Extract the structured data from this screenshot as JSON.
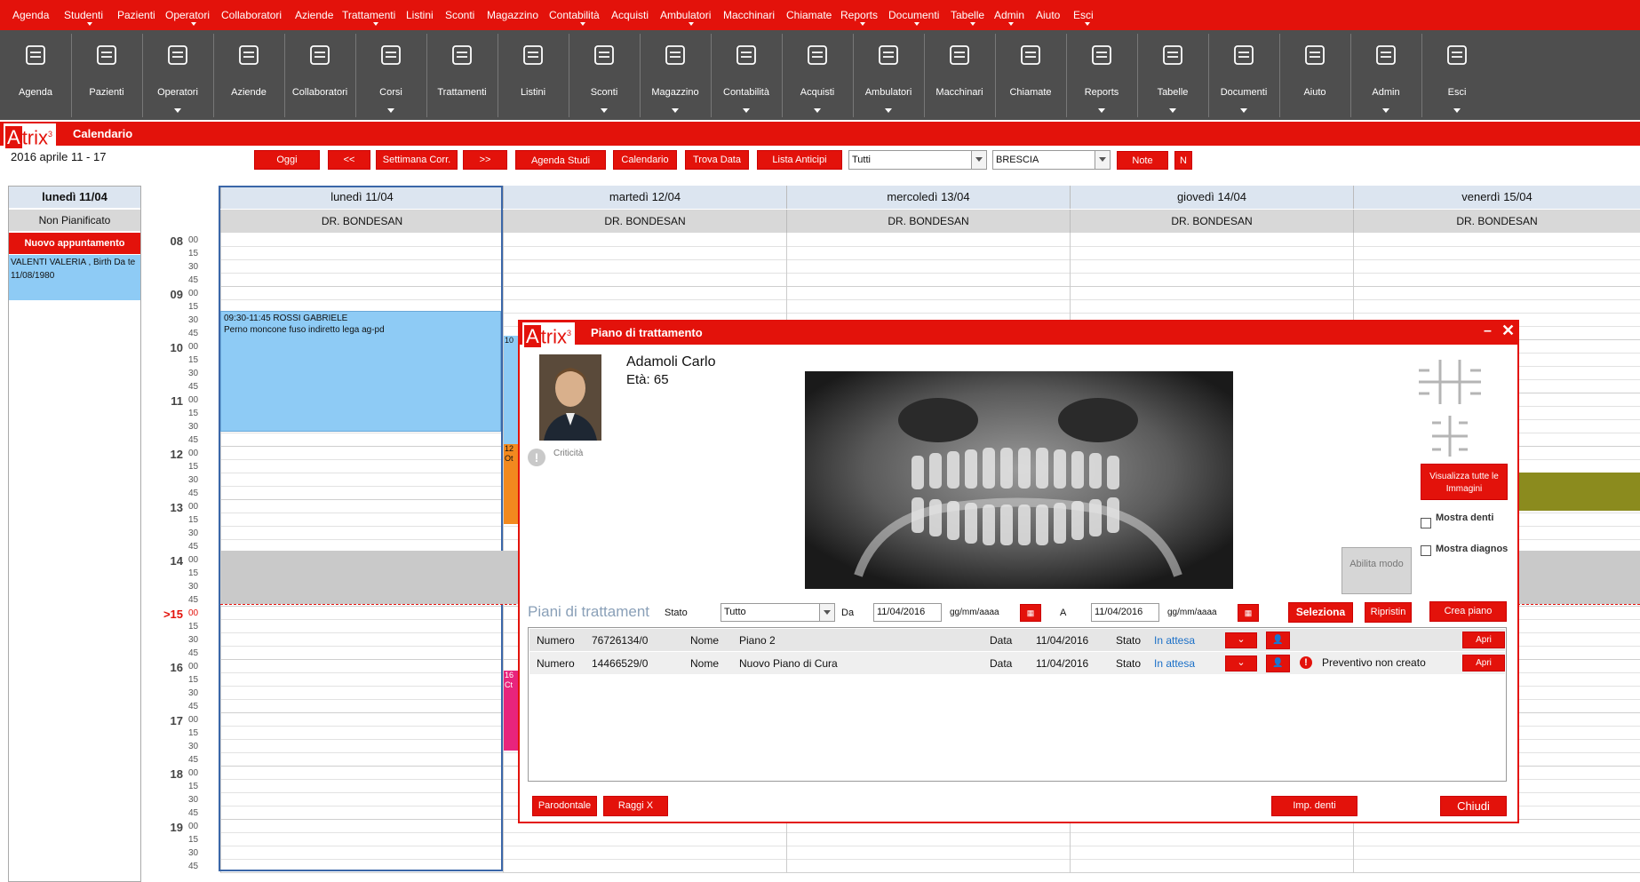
{
  "menu": [
    "Agenda",
    "Studenti",
    "Pazienti",
    "Operatori",
    "Collaboratori",
    "Aziende",
    "Trattamenti",
    "Listini",
    "Sconti",
    "Magazzino",
    "Contabilità",
    "Acquisti",
    "Ambulatori",
    "Macchinari",
    "Chiamate",
    "Reports",
    "Documenti",
    "Tabelle",
    "Admin",
    "Aiuto",
    "Esci"
  ],
  "toolbar": [
    "Agenda",
    "Pazienti",
    "Operatori",
    "Aziende",
    "Collaboratori",
    "Corsi",
    "Trattamenti",
    "Listini",
    "Sconti",
    "Magazzino",
    "Contabilità",
    "Acquisti",
    "Ambulatori",
    "Macchinari",
    "Chiamate",
    "Reports",
    "Tabelle",
    "Documenti",
    "Aiuto",
    "Admin",
    "Esci"
  ],
  "brand": {
    "logo_a": "A",
    "logo_rest": "trix",
    "logo_sup": "3"
  },
  "window_title": "Calendario",
  "week_label": "2016 aprile 11 - 17",
  "nav": {
    "oggi": "Oggi",
    "prev": "<<",
    "settimana": "Settimana Corr.",
    "next": ">>",
    "agenda_studi": "Agenda Studi",
    "calendario": "Calendario",
    "trova_data": "Trova Data",
    "lista_anticipi": "Lista Anticipi",
    "filter_operator": "Tutti",
    "filter_city": "BRESCIA",
    "note": "Note",
    "n": "N"
  },
  "sidebar": {
    "day": "lunedì 11/04",
    "unplanned": "Non Pianificato",
    "new_appointment": "Nuovo appuntamento",
    "pending_item": "VALENTI VALERIA , Birth Da te 11/08/1980"
  },
  "hours": [
    "08",
    "09",
    "10",
    "11",
    "12",
    "13",
    "14",
    ">15",
    "16",
    "17",
    "18",
    "19"
  ],
  "minutes": [
    "00",
    "15",
    "30",
    "45"
  ],
  "days": [
    {
      "label": "lunedì 11/04",
      "doctor": "DR. BONDESAN"
    },
    {
      "label": "martedì 12/04",
      "doctor": "DR. BONDESAN"
    },
    {
      "label": "mercoledì 13/04",
      "doctor": "DR. BONDESAN"
    },
    {
      "label": "giovedì 14/04",
      "doctor": "DR. BONDESAN"
    },
    {
      "label": "venerdì 15/04",
      "doctor": "DR. BONDESAN"
    }
  ],
  "appointment": {
    "time": "09:30-11:45 ROSSI GABRIELE",
    "desc": "Perno moncone fuso indiretto lega ag-pd"
  },
  "partial_events": {
    "e10": "10",
    "e12a": "12",
    "e12b": "Ot",
    "e16a": "16",
    "e16b": "Ct"
  },
  "dialog": {
    "title": "Piano di trattamento",
    "patient_name": "Adamoli Carlo",
    "patient_age": "Età: 65",
    "criticita": "Criticità",
    "view_all_images": "Visualizza tutte le Immagini",
    "show_teeth": "Mostra denti",
    "show_diagnosis": "Mostra diagnos",
    "enable_mode": "Abilita modo",
    "plans_label": "Piani di trattament",
    "stato_label": "Stato",
    "stato_value": "Tutto",
    "da_label": "Da",
    "date_from": "11/04/2016",
    "date_placeholder": "gg/mm/aaaa",
    "a_label": "A",
    "date_to": "11/04/2016",
    "seleziona": "Seleziona",
    "ripristin": "Ripristin",
    "crea_piano": "Crea piano",
    "plans": [
      {
        "numero_label": "Numero",
        "numero": "76726134/0",
        "nome_label": "Nome",
        "nome": "Piano 2",
        "data_label": "Data",
        "data": "11/04/2016",
        "stato_label": "Stato",
        "stato": "In attesa",
        "warning": "",
        "apri": "Apri"
      },
      {
        "numero_label": "Numero",
        "numero": "14466529/0",
        "nome_label": "Nome",
        "nome": "Nuovo Piano di Cura",
        "data_label": "Data",
        "data": "11/04/2016",
        "stato_label": "Stato",
        "stato": "In attesa",
        "warning": "Preventivo non creato",
        "apri": "Apri"
      }
    ],
    "parodontale": "Parodontale",
    "raggi_x": "Raggi X",
    "imp_denti": "Imp. denti",
    "chiudi": "Chiudi"
  },
  "colors": {
    "brand_red": "#e3120b",
    "toolbar_bg": "#4e4e4e",
    "appointment_blue": "#8ecbf5",
    "status_link": "#1a6fc7"
  }
}
